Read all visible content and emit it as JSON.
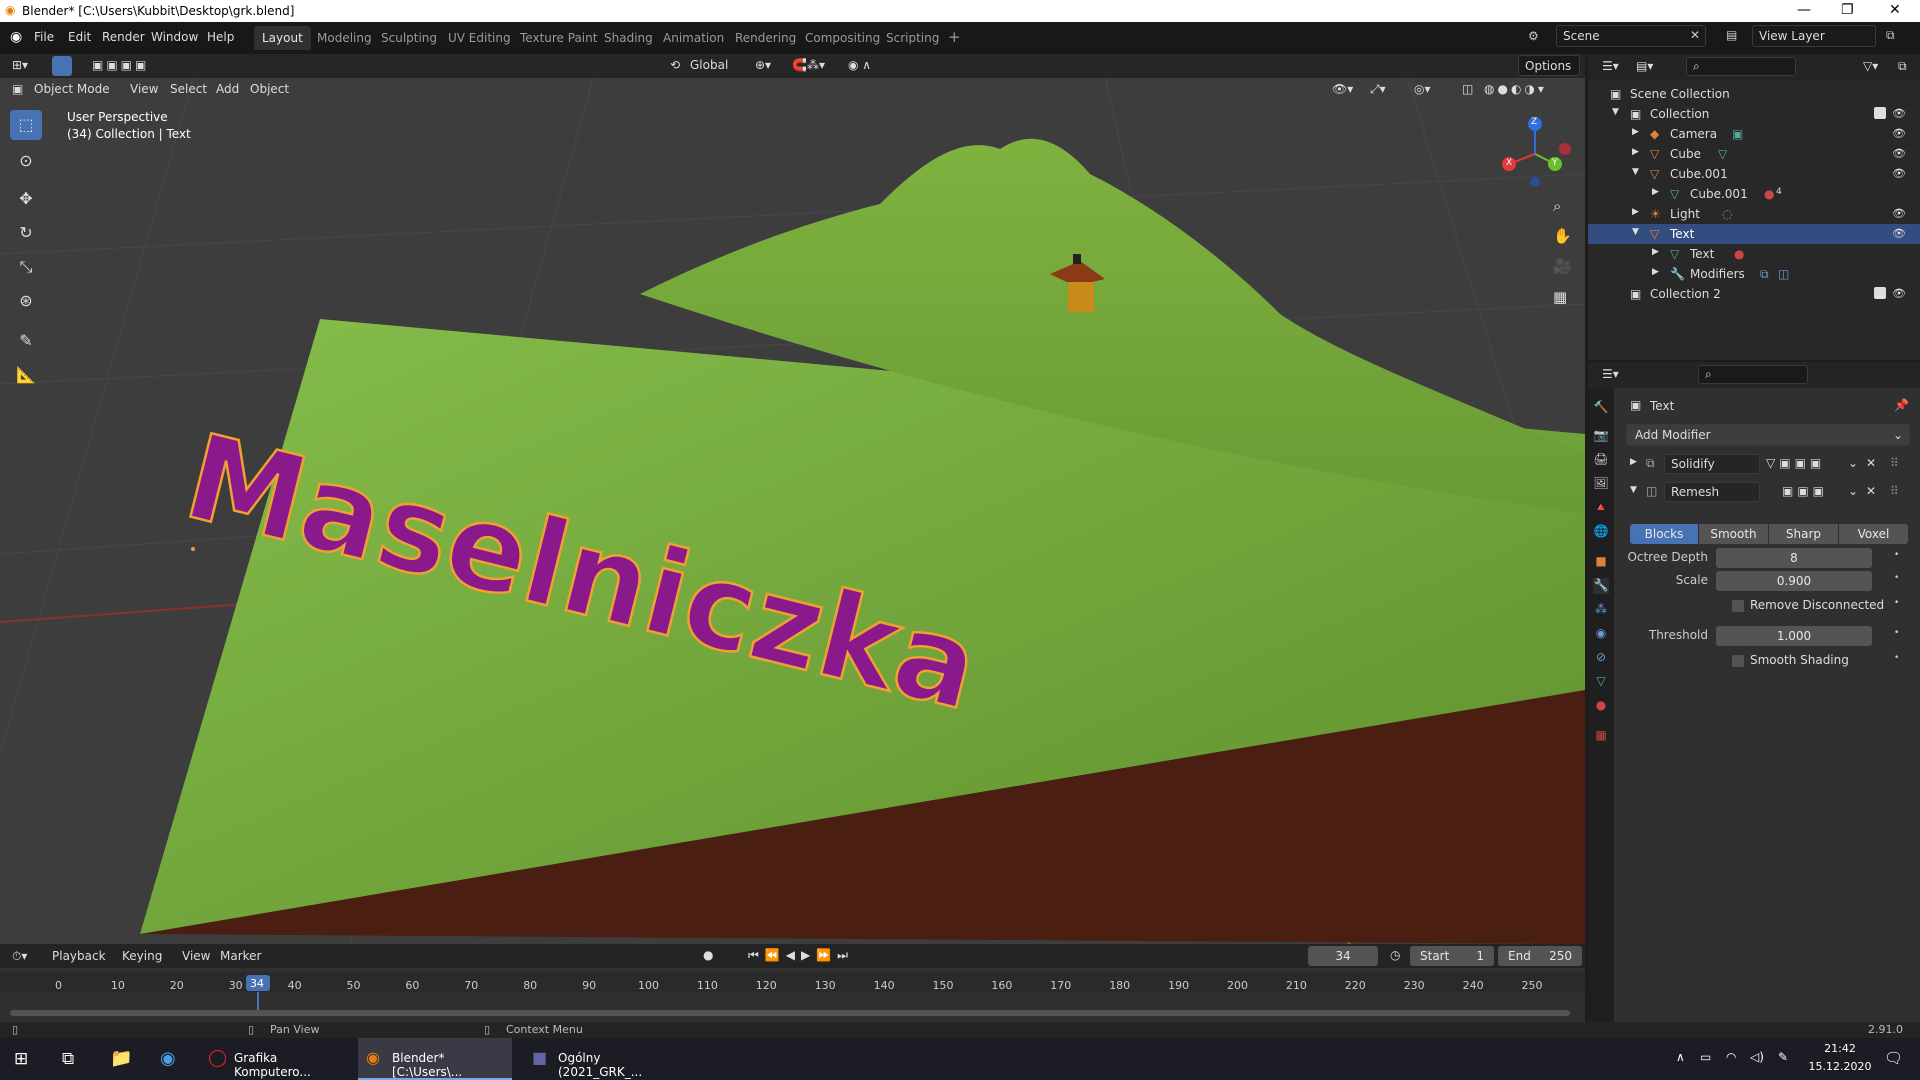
{
  "window": {
    "title": "Blender* [C:\\Users\\Kubbit\\Desktop\\grk.blend]",
    "minimize": "—",
    "maximize": "❐",
    "close": "✕"
  },
  "menu": {
    "items": [
      "File",
      "Edit",
      "Render",
      "Window",
      "Help"
    ]
  },
  "workspaces": {
    "active": "Layout",
    "tabs": [
      "Layout",
      "Modeling",
      "Sculpting",
      "UV Editing",
      "Texture Paint",
      "Shading",
      "Animation",
      "Rendering",
      "Compositing",
      "Scripting"
    ],
    "add": "+"
  },
  "scene": {
    "name": "Scene",
    "view_layer": "View Layer"
  },
  "viewport_header": {
    "mode": "Object Mode",
    "view": "View",
    "select": "Select",
    "add": "Add",
    "object": "Object",
    "transform": "Global",
    "options": "Options"
  },
  "viewport": {
    "perspective": "User Perspective",
    "context": "(34) Collection | Text",
    "text_object": "Maselniczka",
    "gizmo": {
      "x": "X",
      "y": "Y",
      "z": "Z"
    }
  },
  "outliner": {
    "root": "Scene Collection",
    "rows": [
      {
        "label": "Collection",
        "kind": "collection"
      },
      {
        "label": "Camera",
        "kind": "camera"
      },
      {
        "label": "Cube",
        "kind": "mesh"
      },
      {
        "label": "Cube.001",
        "kind": "mesh"
      },
      {
        "label": "Cube.001",
        "kind": "mesh-data"
      },
      {
        "label": "Light",
        "kind": "light"
      },
      {
        "label": "Text",
        "kind": "text"
      },
      {
        "label": "Text",
        "kind": "text-data"
      },
      {
        "label": "Modifiers",
        "kind": "modifiers"
      },
      {
        "label": "Collection 2",
        "kind": "collection"
      }
    ],
    "mesh_badge": "4"
  },
  "properties": {
    "object": "Text",
    "add_modifier": "Add Modifier",
    "modifiers": [
      {
        "name": "Solidify"
      },
      {
        "name": "Remesh"
      }
    ],
    "remesh_modes": [
      "Blocks",
      "Smooth",
      "Sharp",
      "Voxel"
    ],
    "active_mode": "Blocks",
    "fields": {
      "octree_label": "Octree Depth",
      "octree_value": "8",
      "scale_label": "Scale",
      "scale_value": "0.900",
      "remove_disconnected": "Remove Disconnected",
      "threshold_label": "Threshold",
      "threshold_value": "1.000",
      "smooth_shading": "Smooth Shading"
    }
  },
  "timeline": {
    "menus": [
      "Playback",
      "Keying",
      "View",
      "Marker"
    ],
    "current_frame": "34",
    "start_label": "Start",
    "start": "1",
    "end_label": "End",
    "end": "250",
    "ruler": [
      "0",
      "10",
      "20",
      "30",
      "40",
      "50",
      "60",
      "70",
      "80",
      "90",
      "100",
      "110",
      "120",
      "130",
      "140",
      "150",
      "160",
      "170",
      "180",
      "190",
      "200",
      "210",
      "220",
      "230",
      "240",
      "250"
    ]
  },
  "statusbar": {
    "pan": "Pan View",
    "context": "Context Menu",
    "version": "2.91.0"
  },
  "taskbar": {
    "items": [
      {
        "label": "Grafika Komputero..."
      },
      {
        "label": "Blender* [C:\\Users\\..."
      },
      {
        "label": "Ogólny (2021_GRK_..."
      }
    ],
    "time": "21:42",
    "date": "15.12.2020"
  },
  "colors": {
    "accent": "#4772b3",
    "ground": "#6fa23a",
    "text_purple": "#8a1a8c",
    "outline_orange": "#f0a030"
  }
}
